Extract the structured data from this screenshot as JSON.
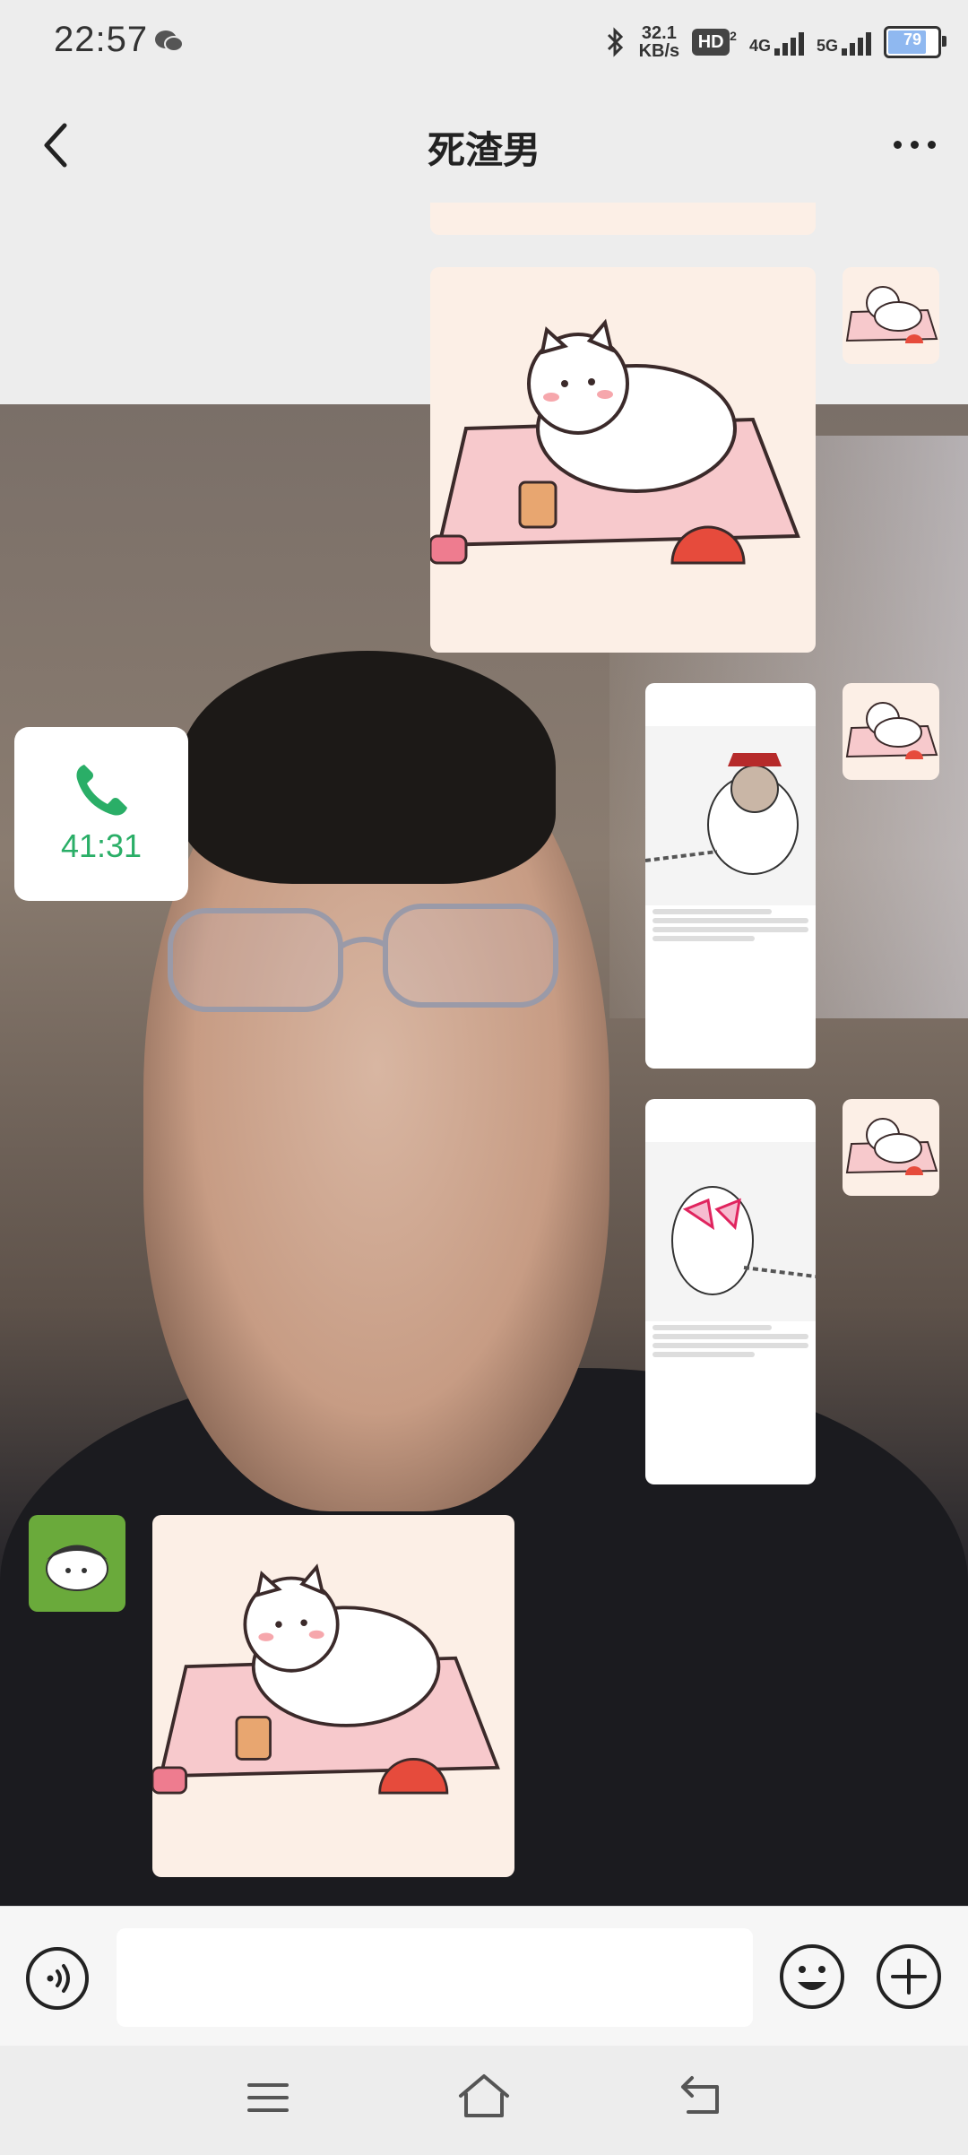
{
  "status_bar": {
    "time": "22:57",
    "network_speed_value": "32.1",
    "network_speed_unit": "KB/s",
    "hd_label": "HD",
    "hd_sub": "2",
    "signal1_label": "4G",
    "signal2_label": "5G",
    "battery_level": "79"
  },
  "nav": {
    "title": "死渣男"
  },
  "messages": {
    "call_duration": "41:31"
  },
  "input": {
    "placeholder": ""
  },
  "colors": {
    "background": "#ededed",
    "call_green": "#2aae67",
    "sticker_pink": "#fcefe6",
    "avatar_green": "#6aaa3b"
  },
  "icons": [
    "back-arrow-icon",
    "more-icon",
    "phone-icon",
    "voice-icon",
    "emoji-icon",
    "plus-icon",
    "menu-icon",
    "home-icon",
    "back-icon"
  ]
}
